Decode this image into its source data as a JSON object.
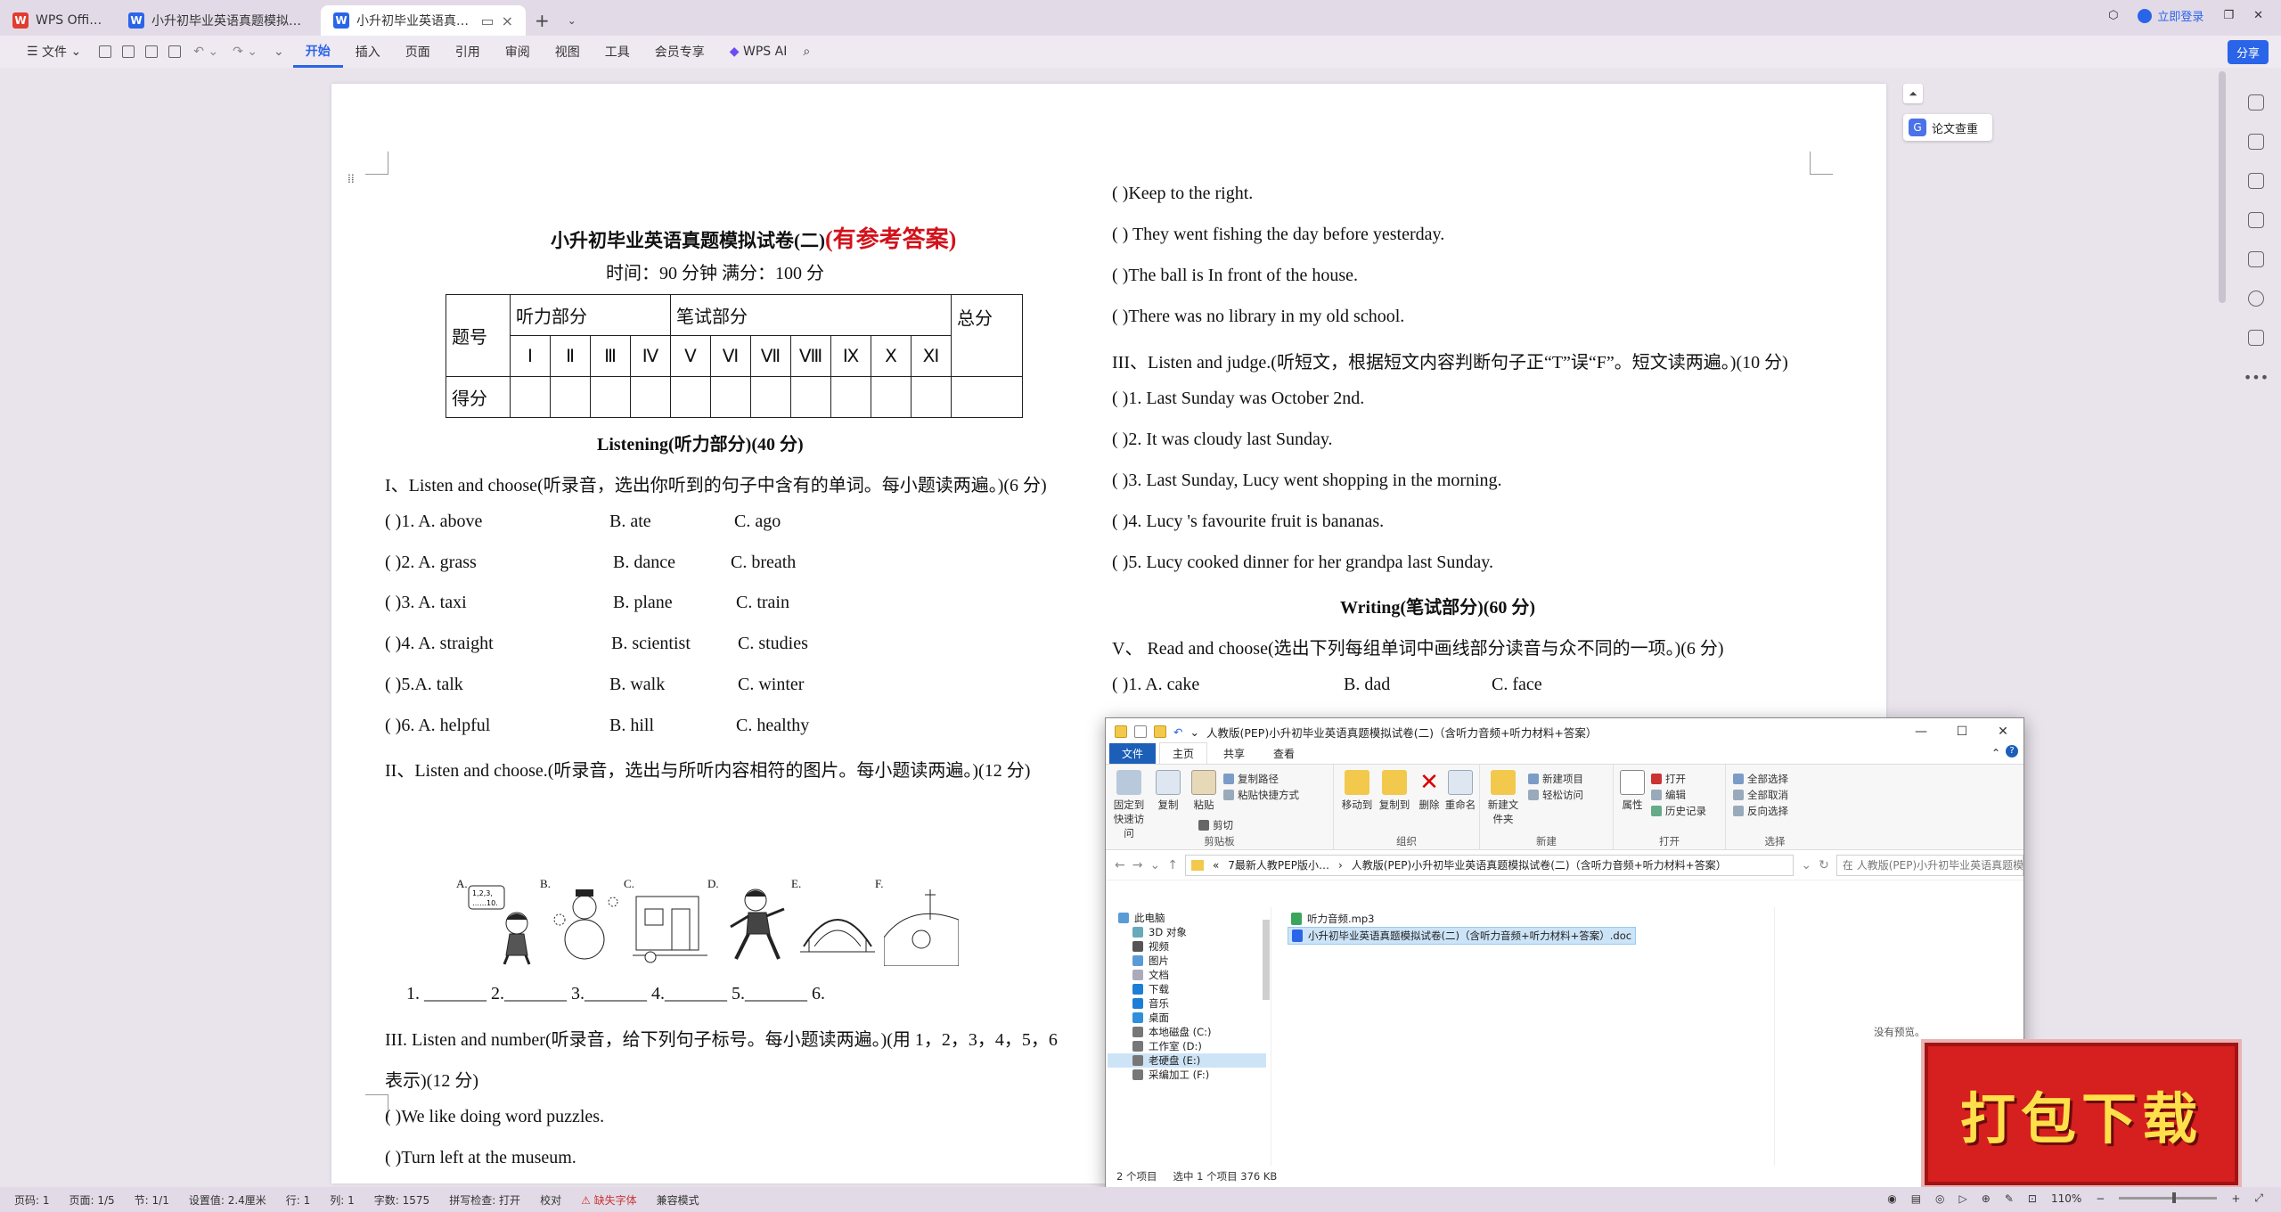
{
  "tabs": {
    "app": "WPS Office",
    "doc1": "小升初毕业英语真题模拟试卷(一)（含…",
    "doc2": "小升初毕业英语真题模拟试卷…",
    "login": "立即登录",
    "share": "分享"
  },
  "ribbon": {
    "file": "文件",
    "items": [
      "开始",
      "插入",
      "页面",
      "引用",
      "审阅",
      "视图",
      "工具",
      "会员专享"
    ],
    "ai": "WPS AI"
  },
  "side": {
    "paper_check": "论文查重"
  },
  "doc": {
    "title": "小升初毕业英语真题模拟试卷(二)",
    "title_red": "(有参考答案)",
    "time": "时间：90 分钟    满分：100 分",
    "table": {
      "r1c1": "题号",
      "listen": "听力部分",
      "written": "笔试部分",
      "total": "总分",
      "romans": [
        "Ⅰ",
        "Ⅱ",
        "Ⅲ",
        "Ⅳ",
        "Ⅴ",
        "Ⅵ",
        "Ⅶ",
        "Ⅷ",
        "Ⅸ",
        "Ⅹ",
        "Ⅺ"
      ],
      "score": "得分"
    },
    "listening_head": "Listening(听力部分)(40 分)",
    "s1": "I、Listen and choose(听录音，选出你听到的句子中含有的单词。每小题读两遍。)(6 分)",
    "q1": [
      {
        "p": "(         )1. A. above",
        "b": "B. ate",
        "c": "C. ago"
      },
      {
        "p": "(         )2. A. grass",
        "b": "B. dance",
        "c": "C. breath"
      },
      {
        "p": "(         )3. A. taxi",
        "b": "B. plane",
        "c": "C. train"
      },
      {
        "p": "(         )4. A. straight",
        "b": "B. scientist",
        "c": "C. studies"
      },
      {
        "p": "(         )5.A. talk",
        "b": "B. walk",
        "c": "C. winter"
      },
      {
        "p": "(         )6. A. helpful",
        "b": "B. hill",
        "c": "C. healthy"
      }
    ],
    "s2": "II、Listen and choose.(听录音，选出与所听内容相符的图片。每小题读两遍。)(12 分)",
    "pic_labels": [
      "A.",
      "B.",
      "C.",
      "D.",
      "E.",
      "F."
    ],
    "pic_a_text": "1,2,3,",
    "pic_a_text2": "……10.",
    "blanks": "1. _______    2._______    3._______    4._______    5._______    6.",
    "s3a": "III. Listen and number(听录音，给下列句子标号。每小题读两遍。)(用 1，2，3，4，5，6",
    "s3b": "表示)(12 分)",
    "l1": "(         )We like doing word puzzles.",
    "l2": "(         )Turn left at the museum.",
    "r": [
      "(         )Keep to the right.",
      "(         ) They went fishing the day before yesterday.",
      "(         )The ball is In front of the house.",
      "(         )There was no library in my old school.",
      "III、Listen and judge.(听短文，根据短文内容判断句子正“T”误“F”。短文读两遍。)(10 分)",
      "(         )1. Last Sunday was October 2nd.",
      "(         )2. It was cloudy last Sunday.",
      "(         )3. Last Sunday, Lucy went shopping in the morning.",
      "(         )4. Lucy 's favourite fruit is bananas.",
      "(         )5. Lucy cooked dinner for her grandpa last Sunday."
    ],
    "writing_head": "Writing(笔试部分)(60 分)",
    "s5": "V、    Read and choose(选出下列每组单词中画线部分读音与众不同的一项。)(6 分)",
    "q5": {
      "p": "(         )1. A. cake",
      "b": "B. dad",
      "c": "C. face"
    }
  },
  "status": {
    "page": "页码: 1",
    "pages": "页面: 1/5",
    "section": "节: 1/1",
    "setting": "设置值: 2.4厘米",
    "row": "行: 1",
    "col": "列: 1",
    "words": "字数: 1575",
    "spell": "拼写检查: 打开",
    "proof": "校对",
    "missing_font": "缺失字体",
    "compat": "兼容模式",
    "zoom": "110%"
  },
  "explorer": {
    "title": "人教版(PEP)小升初毕业英语真题模拟试卷(二)（含听力音频+听力材料+答案）",
    "tabs": [
      "文件",
      "主页",
      "共享",
      "查看"
    ],
    "groups": {
      "clipboard": "剪贴板",
      "organize": "组织",
      "new": "新建",
      "open": "打开",
      "select": "选择"
    },
    "buttons": {
      "pin": "固定到快速访问",
      "copy": "复制",
      "paste": "粘贴",
      "copy_path": "复制路径",
      "paste_shortcut": "粘贴快捷方式",
      "cut": "剪切",
      "move_to": "移动到",
      "copy_to": "复制到",
      "delete": "删除",
      "rename": "重命名",
      "new_folder": "新建文件夹",
      "new_item": "新建项目",
      "easy_access": "轻松访问",
      "properties": "属性",
      "open": "打开",
      "edit": "编辑",
      "history": "历史记录",
      "select_all": "全部选择",
      "select_none": "全部取消",
      "invert": "反向选择"
    },
    "path": [
      "«",
      "7最新人教PEP版小…",
      "›",
      "人教版(PEP)小升初毕业英语真题模拟试卷(二)（含听力音频+听力材料+答案）"
    ],
    "search": "在 人教版(PEP)小升初毕业英语真题模…",
    "nav": [
      "此电脑",
      "3D 对象",
      "视频",
      "图片",
      "文档",
      "下载",
      "音乐",
      "桌面",
      "本地磁盘 (C:)",
      "工作室 (D:)",
      "老硬盘 (E:)",
      "采编加工 (F:)"
    ],
    "files": [
      "听力音频.mp3",
      "小升初毕业英语真题模拟试卷(二)（含听力音频+听力材料+答案）.doc"
    ],
    "no_preview": "没有预览。",
    "count": "2 个项目",
    "selected": "选中 1 个项目  376 KB"
  },
  "download_badge": "打包下载"
}
